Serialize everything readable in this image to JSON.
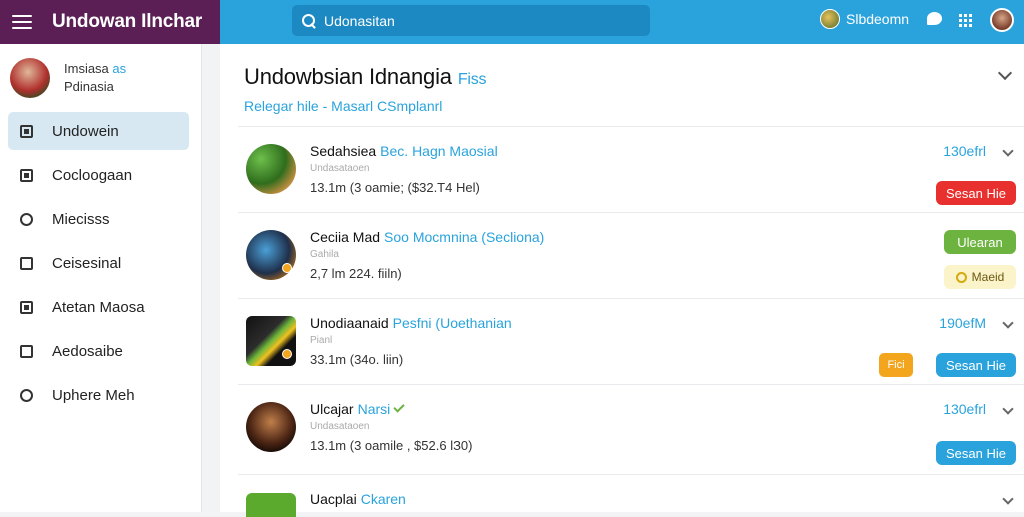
{
  "app": {
    "title": "Undowan Ilnchar"
  },
  "search": {
    "value": "Udonasitan"
  },
  "topnav": {
    "user_name": "Slbdeomn"
  },
  "sidebar": {
    "profile": {
      "line1": "Imsiasa",
      "line1_accent": "as",
      "line2": "Pdinasia"
    },
    "items": [
      {
        "label": "Undowein",
        "icon": "document-icon",
        "active": true
      },
      {
        "label": "Cocloogaan",
        "icon": "folder-icon"
      },
      {
        "label": "Miecisss",
        "icon": "refresh-icon"
      },
      {
        "label": "Ceisesinal",
        "icon": "square-icon"
      },
      {
        "label": "Atetan Maosa",
        "icon": "grid-icon"
      },
      {
        "label": "Aedosaibe",
        "icon": "box-icon"
      },
      {
        "label": "Uphere Meh",
        "icon": "link-icon"
      }
    ]
  },
  "main": {
    "title": "Undowbsian Idnangia",
    "title_tag": "Fiss",
    "subtitle": "Relegar hile - Masarl CSmplanrl"
  },
  "rows": [
    {
      "title": "Sedahsiea",
      "title_accent": "Bec. Hagn Maosial",
      "meta": "Undasataoen",
      "detail": "13.1m (3 oamie; ($32.T4 Hel)",
      "right_label": "130efrl",
      "action": "Sesan Hie"
    },
    {
      "title": "Ceciia Mad",
      "title_accent": "Soo Mocmnina (Secliona)",
      "meta": "Gahila",
      "detail": "2,7 lm 224. fiiln)",
      "status": "Ulearan",
      "status2": "Maeid"
    },
    {
      "title": "Unodiaanaid",
      "title_accent": "Pesfni (Uoethanian",
      "meta": "Pianl",
      "detail": "33.1m (34o. liin)",
      "right_label": "190efM",
      "chip": "Fici",
      "action": "Sesan Hie"
    },
    {
      "title": "Ulcajar",
      "title_accent": "Narsi",
      "meta": "Undasataoen",
      "detail": "13.1m (3 oamile , $52.6 lЗ0)",
      "right_label": "130efrl",
      "action": "Sesan Hie"
    },
    {
      "title": "Uacplai",
      "title_accent": "Ckaren"
    }
  ]
}
